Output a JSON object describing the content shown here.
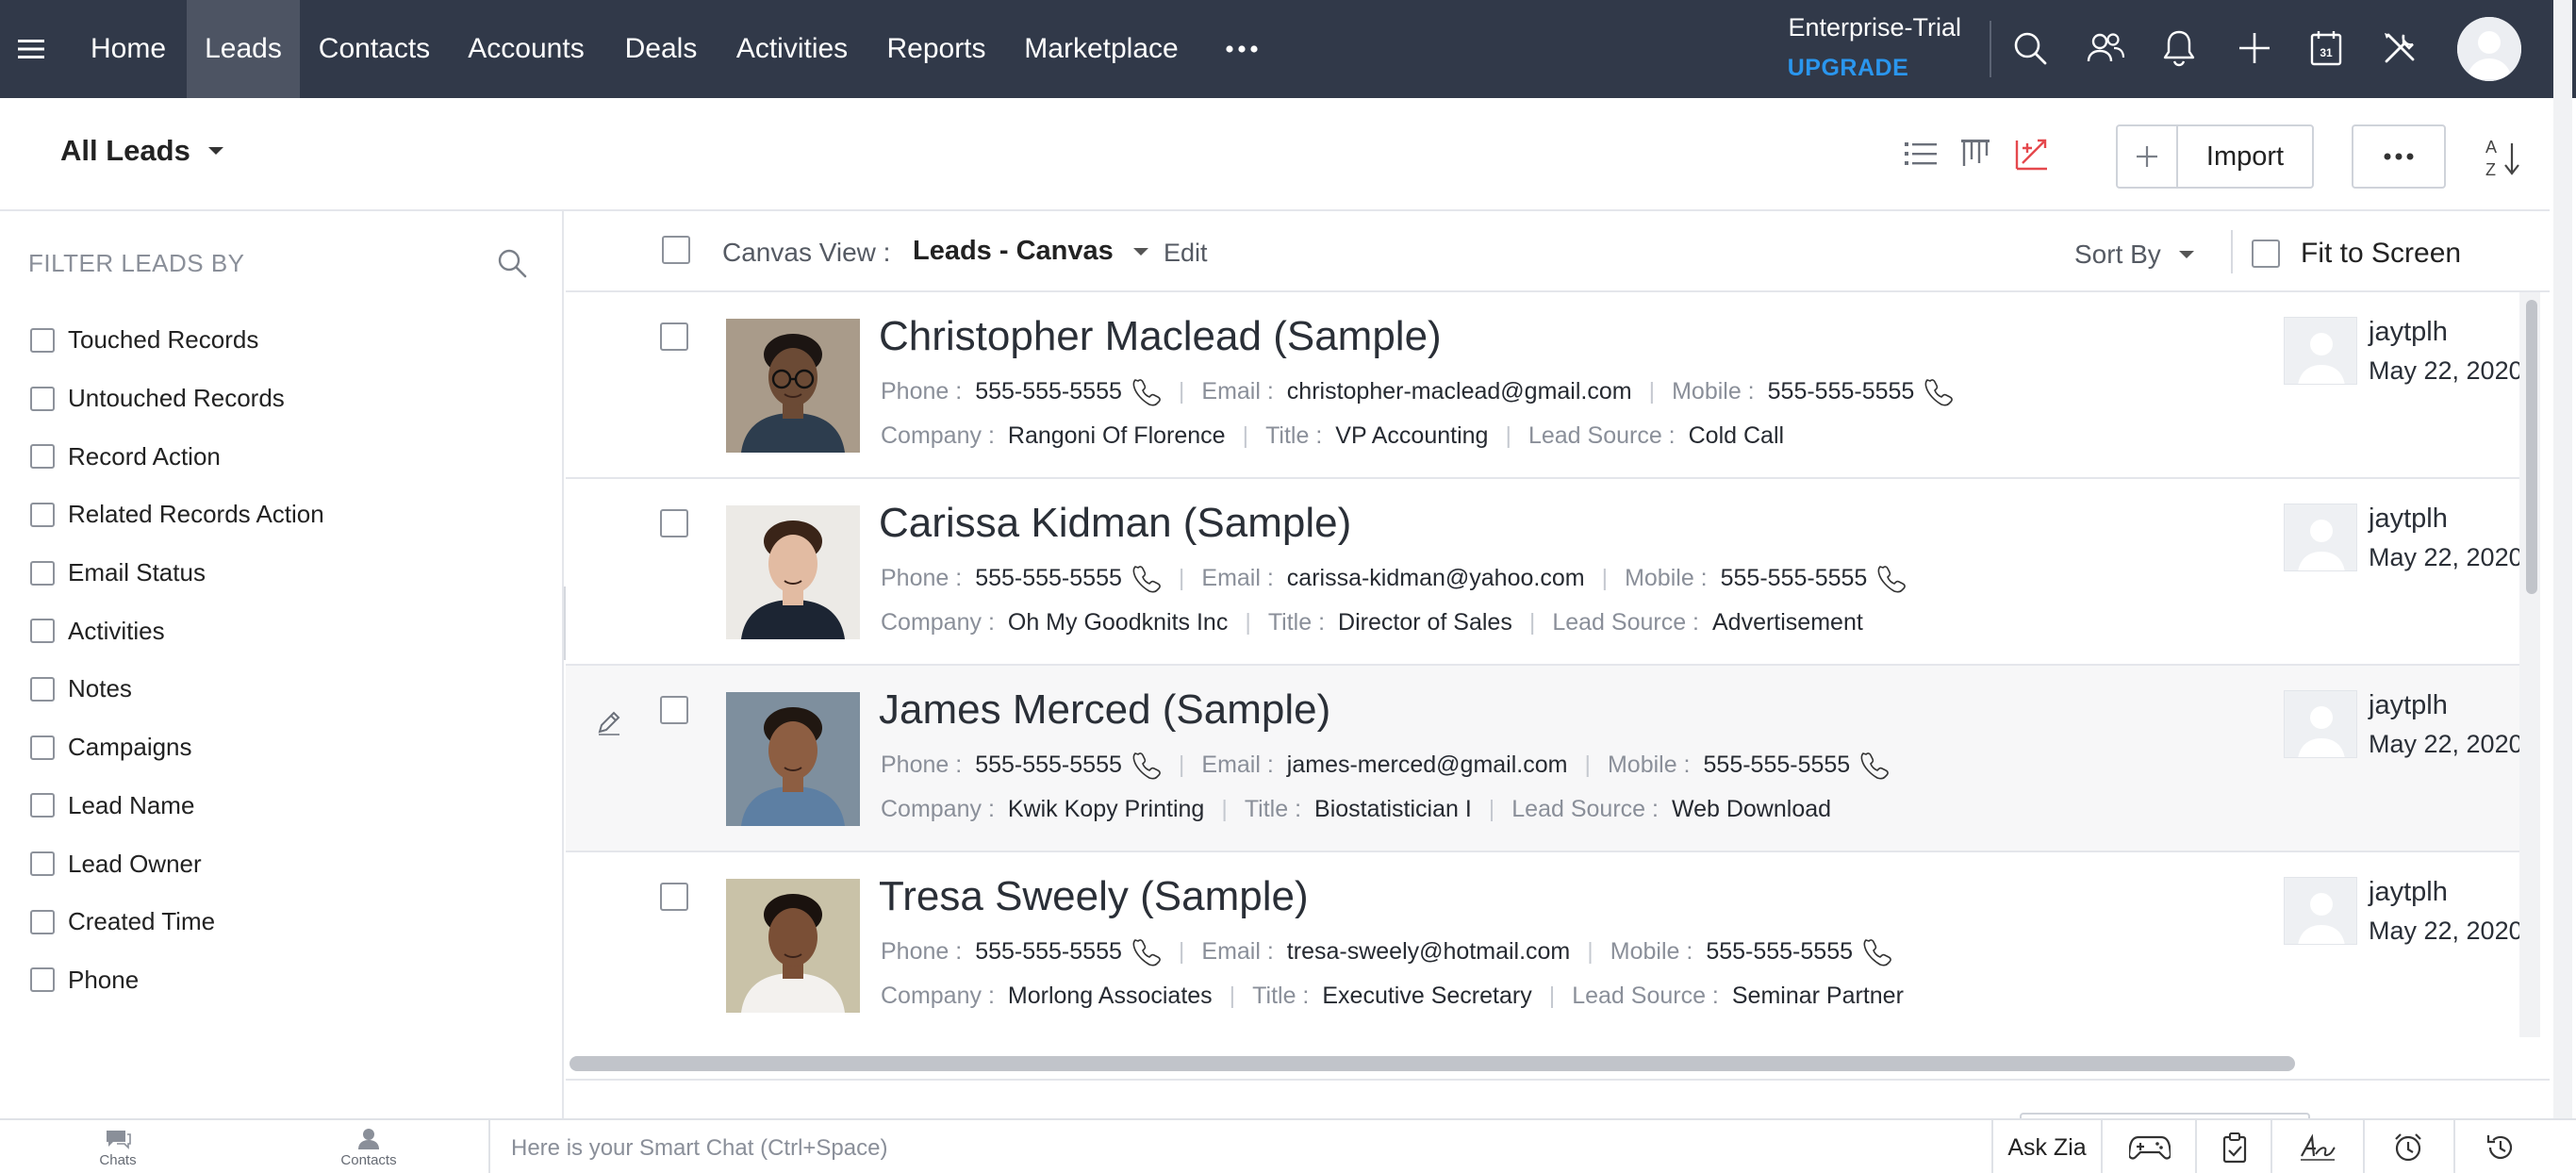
{
  "nav": {
    "menu_icon": "hamburger-icon",
    "items": [
      {
        "label": "Home"
      },
      {
        "label": "Leads",
        "active": true
      },
      {
        "label": "Contacts"
      },
      {
        "label": "Accounts"
      },
      {
        "label": "Deals"
      },
      {
        "label": "Activities"
      },
      {
        "label": "Reports"
      },
      {
        "label": "Marketplace"
      }
    ],
    "more_icon": "more-horizontal-icon",
    "plan": "Enterprise-Trial",
    "upgrade": "UPGRADE",
    "icons": [
      "search-icon",
      "users-icon",
      "bell-icon",
      "plus-icon",
      "calendar-icon",
      "tools-icon"
    ],
    "calendar_day": "31",
    "colors": {
      "nav_bg": "#313949",
      "nav_active": "#4d5463",
      "upgrade": "#2a96ee",
      "accent_red": "#e5484d"
    }
  },
  "subheader": {
    "view_title": "All Leads",
    "view_icons": [
      "list-view-icon",
      "kanban-view-icon",
      "canvas-view-icon"
    ],
    "import_label": "Import",
    "more_icon": "more-horizontal-icon",
    "sort_icon": "sort-az-icon",
    "sort_letters": [
      "A",
      "Z"
    ]
  },
  "sidebar": {
    "title": "FILTER LEADS BY",
    "filters": [
      {
        "label": "Touched Records"
      },
      {
        "label": "Untouched Records"
      },
      {
        "label": "Record Action"
      },
      {
        "label": "Related Records Action"
      },
      {
        "label": "Email Status"
      },
      {
        "label": "Activities"
      },
      {
        "label": "Notes"
      },
      {
        "label": "Campaigns"
      },
      {
        "label": "Lead Name"
      },
      {
        "label": "Lead Owner"
      },
      {
        "label": "Created Time"
      },
      {
        "label": "Phone"
      }
    ]
  },
  "canvas": {
    "view_label": "Canvas View :",
    "view_value": "Leads - Canvas",
    "edit_label": "Edit",
    "sort_label": "Sort By",
    "fit_label": "Fit to Screen"
  },
  "records": [
    {
      "name": "Christopher Maclead (Sample)",
      "phone_label": "Phone :",
      "phone": "555-555-5555",
      "email_label": "Email :",
      "email": "christopher-maclead@gmail.com",
      "mobile_label": "Mobile :",
      "mobile": "555-555-5555",
      "company_label": "Company :",
      "company": "Rangoni Of Florence",
      "title_label": "Title :",
      "title": "VP Accounting",
      "source_label": "Lead Source :",
      "source": "Cold Call",
      "owner": "jaytplh",
      "date": "May 22, 2020",
      "photo": {
        "skin": "#6b4a35",
        "hair": "#1c1512",
        "shirt": "#2d3d4e",
        "bg": "#a99b8a",
        "glasses": true
      }
    },
    {
      "name": "Carissa Kidman (Sample)",
      "phone_label": "Phone :",
      "phone": "555-555-5555",
      "email_label": "Email :",
      "email": "carissa-kidman@yahoo.com",
      "mobile_label": "Mobile :",
      "mobile": "555-555-5555",
      "company_label": "Company :",
      "company": "Oh My Goodknits Inc",
      "title_label": "Title :",
      "title": "Director of Sales",
      "source_label": "Lead Source :",
      "source": "Advertisement",
      "owner": "jaytplh",
      "date": "May 22, 2020",
      "photo": {
        "skin": "#e2bba2",
        "hair": "#3a2418",
        "shirt": "#1c2533",
        "bg": "#eceae6",
        "glasses": false
      }
    },
    {
      "name": "James Merced (Sample)",
      "phone_label": "Phone :",
      "phone": "555-555-5555",
      "email_label": "Email :",
      "email": "james-merced@gmail.com",
      "mobile_label": "Mobile :",
      "mobile": "555-555-5555",
      "company_label": "Company :",
      "company": "Kwik Kopy Printing",
      "title_label": "Title :",
      "title": "Biostatistician I",
      "source_label": "Lead Source :",
      "source": "Web Download",
      "owner": "jaytplh",
      "date": "May 22, 2020",
      "photo": {
        "skin": "#8d5e42",
        "hair": "#201711",
        "shirt": "#5d7fa3",
        "bg": "#7e8f9e",
        "glasses": false
      }
    },
    {
      "name": "Tresa Sweely (Sample)",
      "phone_label": "Phone :",
      "phone": "555-555-5555",
      "email_label": "Email :",
      "email": "tresa-sweely@hotmail.com",
      "mobile_label": "Mobile :",
      "mobile": "555-555-5555",
      "company_label": "Company :",
      "company": "Morlong Associates",
      "title_label": "Title :",
      "title": "Executive Secretary",
      "source_label": "Lead Source :",
      "source": "Seminar Partner",
      "owner": "jaytplh",
      "date": "May 22, 2020",
      "photo": {
        "skin": "#7a4f36",
        "hair": "#1a120e",
        "shirt": "#f3f1ee",
        "bg": "#c9c2a8",
        "glasses": false
      }
    }
  ],
  "footer": {
    "chats_label": "Chats",
    "contacts_label": "Contacts",
    "smart_chat_placeholder": "Here is your Smart Chat (Ctrl+Space)",
    "ask_zia": "Ask Zia",
    "icons": [
      "gamepad-icon",
      "tasks-icon",
      "signature-icon",
      "alarm-icon",
      "history-icon"
    ]
  }
}
